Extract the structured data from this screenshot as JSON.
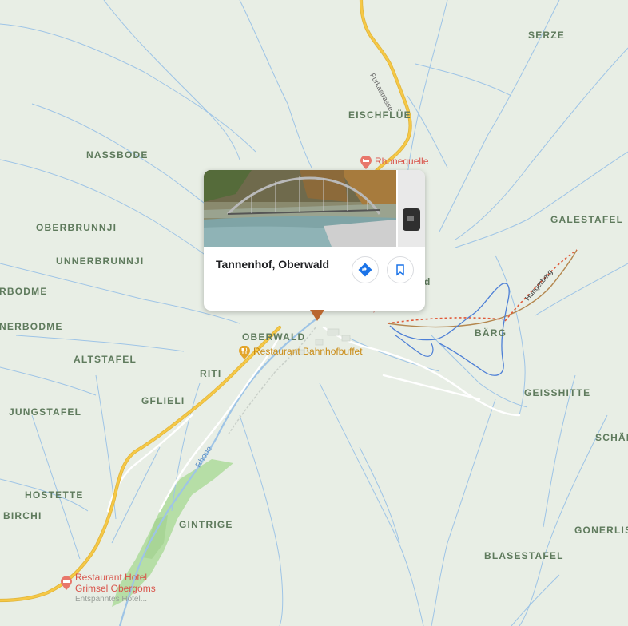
{
  "place_labels": [
    {
      "id": "serze",
      "text": "SERZE"
    },
    {
      "id": "eischflue",
      "text": "EISCHFLÜE"
    },
    {
      "id": "nassbode",
      "text": "NASSBODE"
    },
    {
      "id": "galestafel",
      "text": "GALESTAFEL"
    },
    {
      "id": "oberbrunnji",
      "text": "OBERBRUNNJI"
    },
    {
      "id": "unnerbrunnji",
      "text": "UNNERBRUNNJI"
    },
    {
      "id": "rbodme",
      "text": "RBODME"
    },
    {
      "id": "nerbodme",
      "text": "NERBODME"
    },
    {
      "id": "oberwald",
      "text": "OBERWALD"
    },
    {
      "id": "barg",
      "text": "BÄRG"
    },
    {
      "id": "altstafel",
      "text": "ALTSTAFEL"
    },
    {
      "id": "riti",
      "text": "RITI"
    },
    {
      "id": "geisshitte",
      "text": "GEISSHITTE"
    },
    {
      "id": "gflieli",
      "text": "GFLIELI"
    },
    {
      "id": "jungstafel",
      "text": "JUNGSTAFEL"
    },
    {
      "id": "schar",
      "text": "SCHÄR"
    },
    {
      "id": "hostette",
      "text": "HOSTETTE"
    },
    {
      "id": "birchi",
      "text": "BIRCHI"
    },
    {
      "id": "gintrige",
      "text": "GINTRIGE"
    },
    {
      "id": "gonerlis",
      "text": "GONERLIS"
    },
    {
      "id": "blasestafel",
      "text": "BLASESTAFEL"
    }
  ],
  "pois": {
    "rhonequelle": {
      "name": "Rhonequelle",
      "icon": "hotel-icon",
      "color": "#d9534a"
    },
    "bahnhofbuffet": {
      "name": "Restaurant Bahnhofbuffet",
      "icon": "restaurant-icon",
      "color": "#c98a12"
    },
    "grimsel": {
      "name_line1": "Restaurant Hotel",
      "name_line2": "Grimsel Obergoms",
      "subtitle": "Entspanntes Hotel...",
      "icon": "hotel-icon",
      "color": "#d9534a"
    }
  },
  "road_labels": {
    "furkastrasse": "Furkastrasse",
    "rhone": "Rhone"
  },
  "trail_labels": {
    "hungerberg": "Hungerberg"
  },
  "behind_card_text": {
    "tannenhof_partial": "Tannenhof, Oberwald",
    "d_partial": "d"
  },
  "card": {
    "title": "Tannenhof, Oberwald",
    "directions_icon": "directions-icon",
    "save_icon": "bookmark-icon"
  },
  "colors": {
    "background": "#e8eee5",
    "water": "#9ec4e6",
    "main_road": "#f6c846",
    "minor_road": "#ffffff",
    "forest": "#b6dea6",
    "place_label": "#5e7a5c",
    "hotel_red": "#d9534a",
    "restaurant_orange": "#c98a12"
  }
}
